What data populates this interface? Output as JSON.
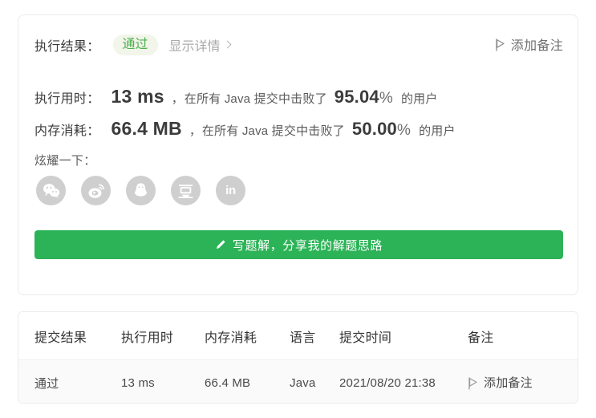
{
  "result_panel": {
    "result_label": "执行结果：",
    "status_badge": "通过",
    "detail_link": "显示详情",
    "add_note_label": "添加备注",
    "runtime": {
      "key": "执行用时：",
      "value": "13 ms",
      "comma": "，",
      "beat_prefix": "在所有 Java 提交中击败了",
      "percent": "95.04",
      "percent_symbol": "%",
      "beat_suffix": "的用户"
    },
    "memory": {
      "key": "内存消耗：",
      "value": "66.4 MB",
      "comma": "，",
      "beat_prefix": "在所有 Java 提交中击败了",
      "percent": "50.00",
      "percent_symbol": "%",
      "beat_suffix": "的用户"
    },
    "share": {
      "title": "炫耀一下：",
      "icons": [
        {
          "name": "wechat-icon",
          "label": ""
        },
        {
          "name": "weibo-icon",
          "label": ""
        },
        {
          "name": "qq-icon",
          "label": ""
        },
        {
          "name": "douban-icon",
          "label": "豆"
        },
        {
          "name": "linkedin-icon",
          "label": "in"
        }
      ]
    },
    "cta_button": "写题解，分享我的解题思路"
  },
  "submissions_table": {
    "headers": [
      "提交结果",
      "执行用时",
      "内存消耗",
      "语言",
      "提交时间",
      "备注"
    ],
    "rows": [
      {
        "status": "通过",
        "runtime": "13 ms",
        "memory": "66.4 MB",
        "language": "Java",
        "submitted_at": "2021/08/20 21:38",
        "note": "添加备注"
      }
    ]
  },
  "colors": {
    "accent_green": "#2cb357",
    "pass_green": "#5fb462",
    "badge_bg": "#f2f5e9",
    "muted": "#aaaaaa",
    "row_bg": "#fafafa",
    "card_border": "#ececec"
  }
}
